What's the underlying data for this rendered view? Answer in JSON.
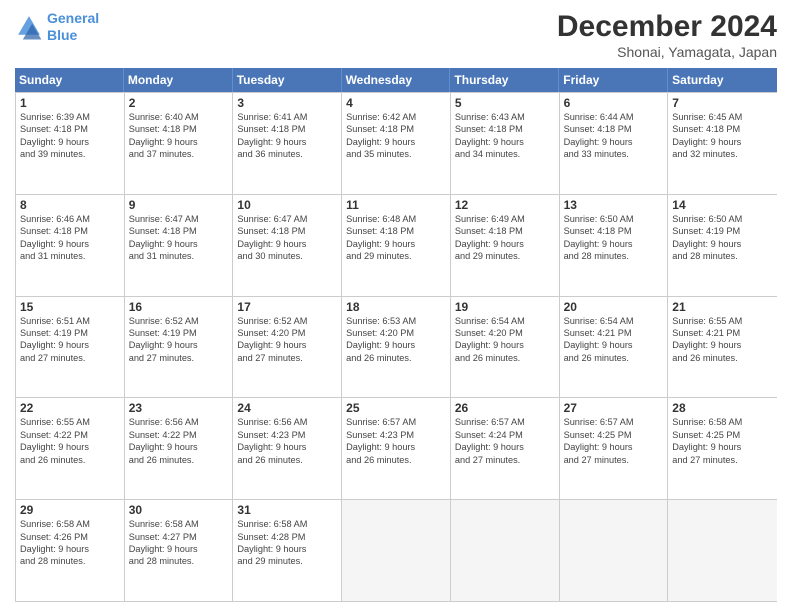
{
  "header": {
    "logo_line1": "General",
    "logo_line2": "Blue",
    "month": "December 2024",
    "location": "Shonai, Yamagata, Japan"
  },
  "days_of_week": [
    "Sunday",
    "Monday",
    "Tuesday",
    "Wednesday",
    "Thursday",
    "Friday",
    "Saturday"
  ],
  "weeks": [
    [
      {
        "day": "1",
        "lines": [
          "Sunrise: 6:39 AM",
          "Sunset: 4:18 PM",
          "Daylight: 9 hours",
          "and 39 minutes."
        ]
      },
      {
        "day": "2",
        "lines": [
          "Sunrise: 6:40 AM",
          "Sunset: 4:18 PM",
          "Daylight: 9 hours",
          "and 37 minutes."
        ]
      },
      {
        "day": "3",
        "lines": [
          "Sunrise: 6:41 AM",
          "Sunset: 4:18 PM",
          "Daylight: 9 hours",
          "and 36 minutes."
        ]
      },
      {
        "day": "4",
        "lines": [
          "Sunrise: 6:42 AM",
          "Sunset: 4:18 PM",
          "Daylight: 9 hours",
          "and 35 minutes."
        ]
      },
      {
        "day": "5",
        "lines": [
          "Sunrise: 6:43 AM",
          "Sunset: 4:18 PM",
          "Daylight: 9 hours",
          "and 34 minutes."
        ]
      },
      {
        "day": "6",
        "lines": [
          "Sunrise: 6:44 AM",
          "Sunset: 4:18 PM",
          "Daylight: 9 hours",
          "and 33 minutes."
        ]
      },
      {
        "day": "7",
        "lines": [
          "Sunrise: 6:45 AM",
          "Sunset: 4:18 PM",
          "Daylight: 9 hours",
          "and 32 minutes."
        ]
      }
    ],
    [
      {
        "day": "8",
        "lines": [
          "Sunrise: 6:46 AM",
          "Sunset: 4:18 PM",
          "Daylight: 9 hours",
          "and 31 minutes."
        ]
      },
      {
        "day": "9",
        "lines": [
          "Sunrise: 6:47 AM",
          "Sunset: 4:18 PM",
          "Daylight: 9 hours",
          "and 31 minutes."
        ]
      },
      {
        "day": "10",
        "lines": [
          "Sunrise: 6:47 AM",
          "Sunset: 4:18 PM",
          "Daylight: 9 hours",
          "and 30 minutes."
        ]
      },
      {
        "day": "11",
        "lines": [
          "Sunrise: 6:48 AM",
          "Sunset: 4:18 PM",
          "Daylight: 9 hours",
          "and 29 minutes."
        ]
      },
      {
        "day": "12",
        "lines": [
          "Sunrise: 6:49 AM",
          "Sunset: 4:18 PM",
          "Daylight: 9 hours",
          "and 29 minutes."
        ]
      },
      {
        "day": "13",
        "lines": [
          "Sunrise: 6:50 AM",
          "Sunset: 4:18 PM",
          "Daylight: 9 hours",
          "and 28 minutes."
        ]
      },
      {
        "day": "14",
        "lines": [
          "Sunrise: 6:50 AM",
          "Sunset: 4:19 PM",
          "Daylight: 9 hours",
          "and 28 minutes."
        ]
      }
    ],
    [
      {
        "day": "15",
        "lines": [
          "Sunrise: 6:51 AM",
          "Sunset: 4:19 PM",
          "Daylight: 9 hours",
          "and 27 minutes."
        ]
      },
      {
        "day": "16",
        "lines": [
          "Sunrise: 6:52 AM",
          "Sunset: 4:19 PM",
          "Daylight: 9 hours",
          "and 27 minutes."
        ]
      },
      {
        "day": "17",
        "lines": [
          "Sunrise: 6:52 AM",
          "Sunset: 4:20 PM",
          "Daylight: 9 hours",
          "and 27 minutes."
        ]
      },
      {
        "day": "18",
        "lines": [
          "Sunrise: 6:53 AM",
          "Sunset: 4:20 PM",
          "Daylight: 9 hours",
          "and 26 minutes."
        ]
      },
      {
        "day": "19",
        "lines": [
          "Sunrise: 6:54 AM",
          "Sunset: 4:20 PM",
          "Daylight: 9 hours",
          "and 26 minutes."
        ]
      },
      {
        "day": "20",
        "lines": [
          "Sunrise: 6:54 AM",
          "Sunset: 4:21 PM",
          "Daylight: 9 hours",
          "and 26 minutes."
        ]
      },
      {
        "day": "21",
        "lines": [
          "Sunrise: 6:55 AM",
          "Sunset: 4:21 PM",
          "Daylight: 9 hours",
          "and 26 minutes."
        ]
      }
    ],
    [
      {
        "day": "22",
        "lines": [
          "Sunrise: 6:55 AM",
          "Sunset: 4:22 PM",
          "Daylight: 9 hours",
          "and 26 minutes."
        ]
      },
      {
        "day": "23",
        "lines": [
          "Sunrise: 6:56 AM",
          "Sunset: 4:22 PM",
          "Daylight: 9 hours",
          "and 26 minutes."
        ]
      },
      {
        "day": "24",
        "lines": [
          "Sunrise: 6:56 AM",
          "Sunset: 4:23 PM",
          "Daylight: 9 hours",
          "and 26 minutes."
        ]
      },
      {
        "day": "25",
        "lines": [
          "Sunrise: 6:57 AM",
          "Sunset: 4:23 PM",
          "Daylight: 9 hours",
          "and 26 minutes."
        ]
      },
      {
        "day": "26",
        "lines": [
          "Sunrise: 6:57 AM",
          "Sunset: 4:24 PM",
          "Daylight: 9 hours",
          "and 27 minutes."
        ]
      },
      {
        "day": "27",
        "lines": [
          "Sunrise: 6:57 AM",
          "Sunset: 4:25 PM",
          "Daylight: 9 hours",
          "and 27 minutes."
        ]
      },
      {
        "day": "28",
        "lines": [
          "Sunrise: 6:58 AM",
          "Sunset: 4:25 PM",
          "Daylight: 9 hours",
          "and 27 minutes."
        ]
      }
    ],
    [
      {
        "day": "29",
        "lines": [
          "Sunrise: 6:58 AM",
          "Sunset: 4:26 PM",
          "Daylight: 9 hours",
          "and 28 minutes."
        ]
      },
      {
        "day": "30",
        "lines": [
          "Sunrise: 6:58 AM",
          "Sunset: 4:27 PM",
          "Daylight: 9 hours",
          "and 28 minutes."
        ]
      },
      {
        "day": "31",
        "lines": [
          "Sunrise: 6:58 AM",
          "Sunset: 4:28 PM",
          "Daylight: 9 hours",
          "and 29 minutes."
        ]
      },
      {
        "day": "",
        "lines": []
      },
      {
        "day": "",
        "lines": []
      },
      {
        "day": "",
        "lines": []
      },
      {
        "day": "",
        "lines": []
      }
    ]
  ]
}
